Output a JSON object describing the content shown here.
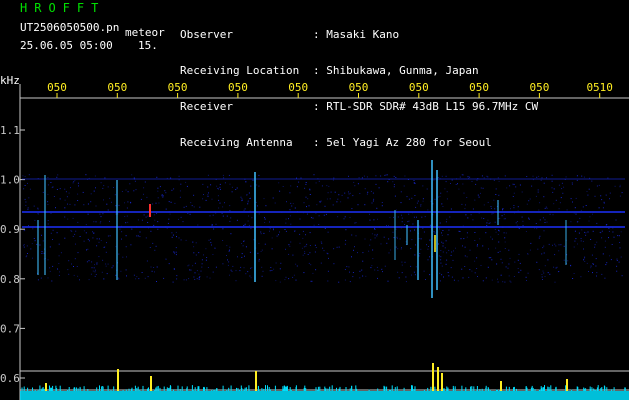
{
  "header": {
    "app_title": "HROFFT",
    "file_name": "UT2506050500.pn",
    "meteor_label": "meteor",
    "datetime": "25.06.05 05:00",
    "sequence": "15.",
    "info": [
      {
        "label": "Observer",
        "value": ": Masaki Kano"
      },
      {
        "label": "Receiving Location",
        "value": ": Shibukawa, Gunma, Japan"
      },
      {
        "label": "Receiver",
        "value": ": RTL-SDR SDR# 43dB L15 96.7MHz CW"
      },
      {
        "label": "Receiving Antenna",
        "value": ": 5el Yagi Az 280 for Seoul"
      }
    ]
  },
  "spectrogram": {
    "unit_label": "kHz",
    "y_ticks": [
      "1.1",
      "1.0",
      "0.9",
      "0.8",
      "0.7",
      "0.6"
    ],
    "x_ticks": [
      "050",
      "050",
      "050",
      "050",
      "050",
      "050",
      "050",
      "050",
      "050",
      "0510"
    ],
    "colors": {
      "axis": "#c8c8c8",
      "label_yellow": "#ffee22",
      "label_green": "#00e000",
      "noise": "#1828d0",
      "signal": "#40c0ff",
      "strong": "#ff3030",
      "baseline": "#00e0ff",
      "peak": "#ffee22"
    }
  }
}
